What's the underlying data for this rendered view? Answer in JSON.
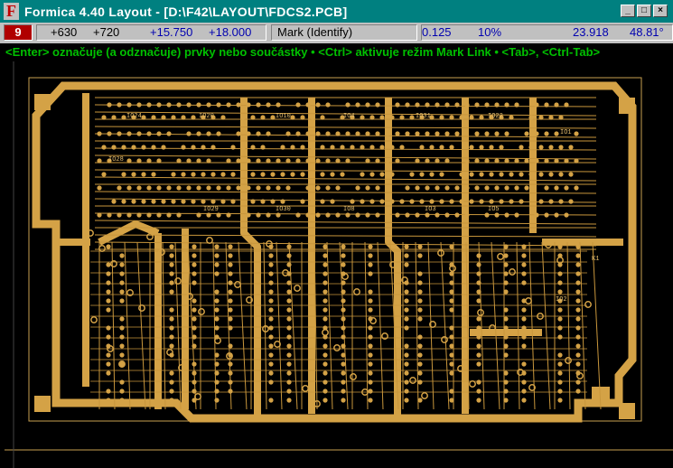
{
  "window": {
    "app_icon_letter": "F",
    "title": "Formica 4.40 Layout - [D:\\F42\\LAYOUT\\FDCS2.PCB]",
    "buttons": {
      "minimize": "_",
      "maximize": "□",
      "close": "×"
    }
  },
  "status": {
    "layer": "9",
    "x1": "+630",
    "y1": "+720",
    "x2": "+15.750",
    "y2": "+18.000",
    "mode": "Mark (Identify)",
    "grid": "0.125",
    "zoom": "10%",
    "dist": "23.918",
    "angle": "48.81°"
  },
  "hint_line": "<Enter> označuje (a odznačuje) prvky nebo součástky  •  <Ctrl> aktivuje režim Mark Link  •  <Tab>, <Ctrl-Tab>",
  "colors": {
    "copper": "#d4a246",
    "trace": "#c8963c",
    "titlebar": "#008080",
    "hint_text": "#00c000",
    "layer_badge": "#b00000"
  },
  "pcb_labels": [
    "IO24",
    "IO20",
    "IO10",
    "IO4",
    "IO31",
    "IO22",
    "IO28",
    "IO29",
    "IO30",
    "IO8",
    "IO3",
    "IO5",
    "IO1",
    "K1",
    "IO2"
  ]
}
